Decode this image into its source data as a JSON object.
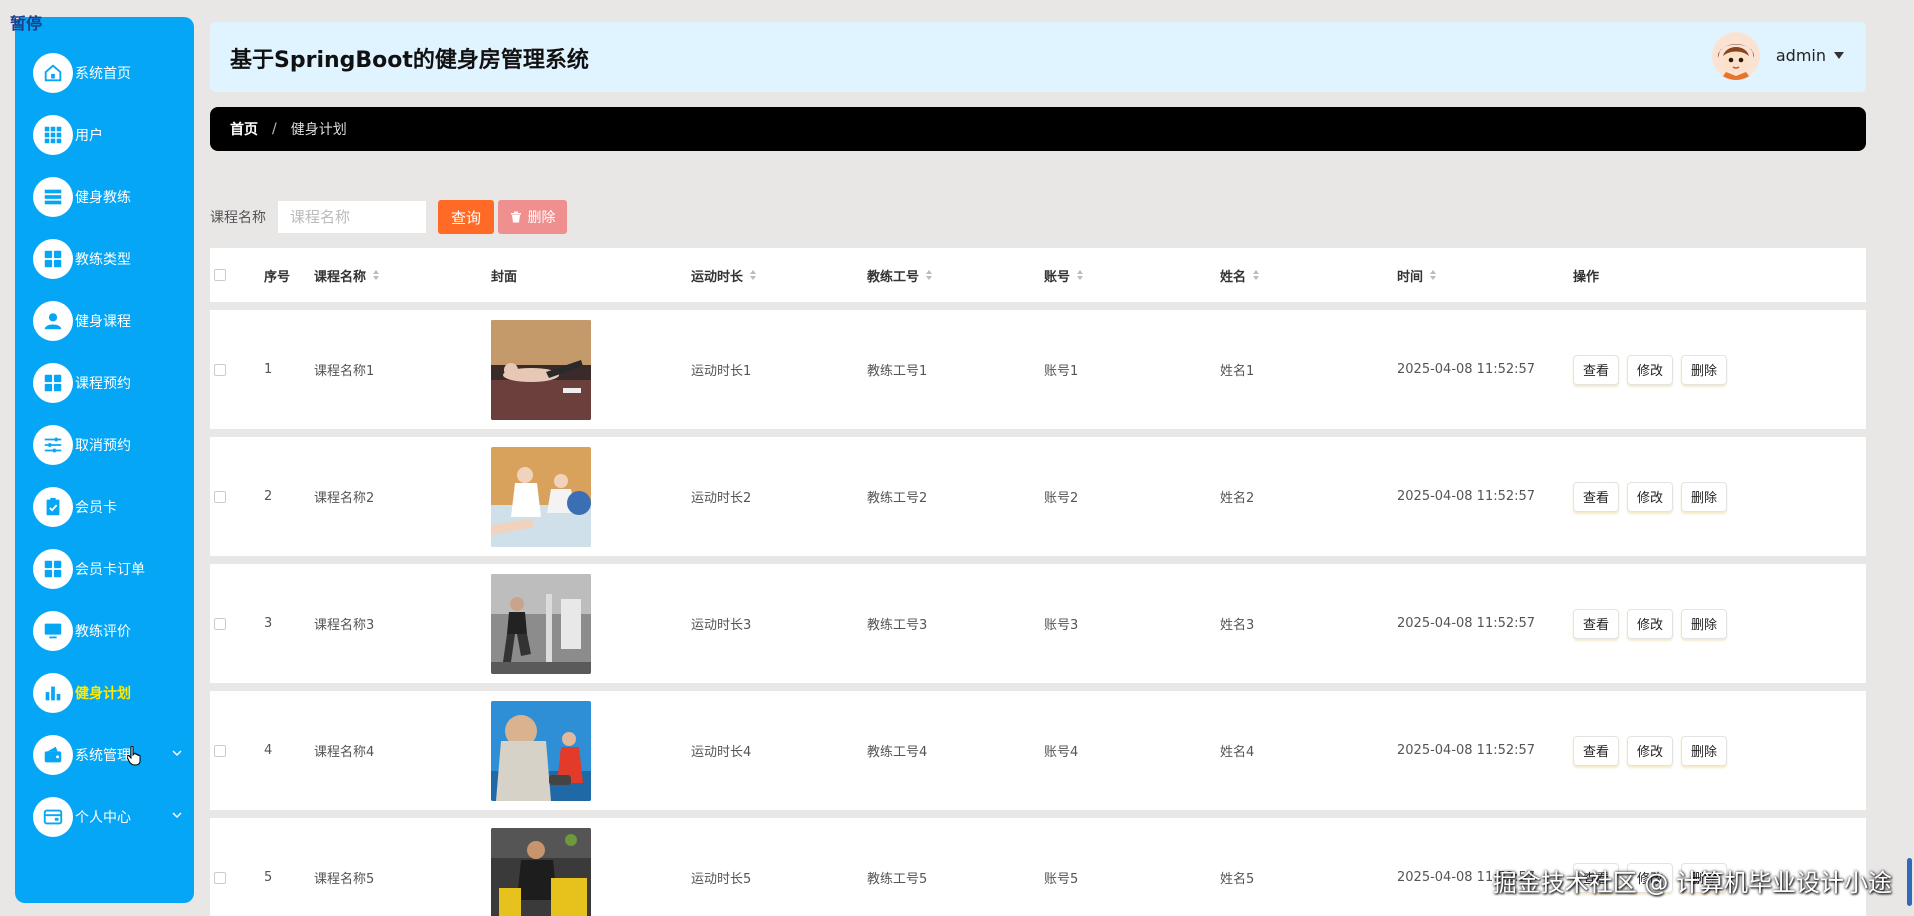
{
  "overlay": {
    "pause_label": "暂停",
    "watermark": "掘金技术社区 @ 计算机毕业设计小途"
  },
  "header": {
    "title": "基于SpringBoot的健身房管理系统",
    "user": "admin"
  },
  "breadcrumb": {
    "home": "首页",
    "separator": "/",
    "current": "健身计划"
  },
  "sidebar": {
    "items": [
      {
        "label": "系统首页",
        "icon": "home-icon"
      },
      {
        "label": "用户",
        "icon": "grid-icon"
      },
      {
        "label": "健身教练",
        "icon": "list-icon"
      },
      {
        "label": "教练类型",
        "icon": "apps-icon"
      },
      {
        "label": "健身课程",
        "icon": "person-icon"
      },
      {
        "label": "课程预约",
        "icon": "apps-icon"
      },
      {
        "label": "取消预约",
        "icon": "sliders-icon"
      },
      {
        "label": "会员卡",
        "icon": "clipboard-check-icon"
      },
      {
        "label": "会员卡订单",
        "icon": "apps-icon"
      },
      {
        "label": "教练评价",
        "icon": "monitor-icon"
      },
      {
        "label": "健身计划",
        "icon": "bar-chart-icon",
        "active": true
      },
      {
        "label": "系统管理",
        "icon": "wallet-icon",
        "expandable": true
      },
      {
        "label": "个人中心",
        "icon": "card-icon",
        "expandable": true
      }
    ]
  },
  "search": {
    "label": "课程名称",
    "placeholder": "课程名称",
    "query_button": "查询",
    "delete_button": "删除"
  },
  "table": {
    "headers": {
      "index": "序号",
      "course": "课程名称",
      "cover": "封面",
      "duration": "运动时长",
      "coach_id": "教练工号",
      "account": "账号",
      "name": "姓名",
      "time": "时间",
      "ops": "操作"
    },
    "actions": {
      "view": "查看",
      "edit": "修改",
      "delete": "删除"
    },
    "rows": [
      {
        "index": "1",
        "course": "课程名称1",
        "duration": "运动时长1",
        "coach_id": "教练工号1",
        "account": "账号1",
        "name": "姓名1",
        "time": "2025-04-08 11:52:57"
      },
      {
        "index": "2",
        "course": "课程名称2",
        "duration": "运动时长2",
        "coach_id": "教练工号2",
        "account": "账号2",
        "name": "姓名2",
        "time": "2025-04-08 11:52:57"
      },
      {
        "index": "3",
        "course": "课程名称3",
        "duration": "运动时长3",
        "coach_id": "教练工号3",
        "account": "账号3",
        "name": "姓名3",
        "time": "2025-04-08 11:52:57"
      },
      {
        "index": "4",
        "course": "课程名称4",
        "duration": "运动时长4",
        "coach_id": "教练工号4",
        "account": "账号4",
        "name": "姓名4",
        "time": "2025-04-08 11:52:57"
      },
      {
        "index": "5",
        "course": "课程名称5",
        "duration": "运动时长5",
        "coach_id": "教练工号5",
        "account": "账号5",
        "name": "姓名5",
        "time": "2025-04-08 11:52:57"
      }
    ]
  },
  "colors": {
    "sidebar": "#04a6f5",
    "active_text": "#ffea00",
    "query_button": "#ff6a27",
    "delete_button": "#f08f8f",
    "header_bg": "#e0f4ff"
  }
}
